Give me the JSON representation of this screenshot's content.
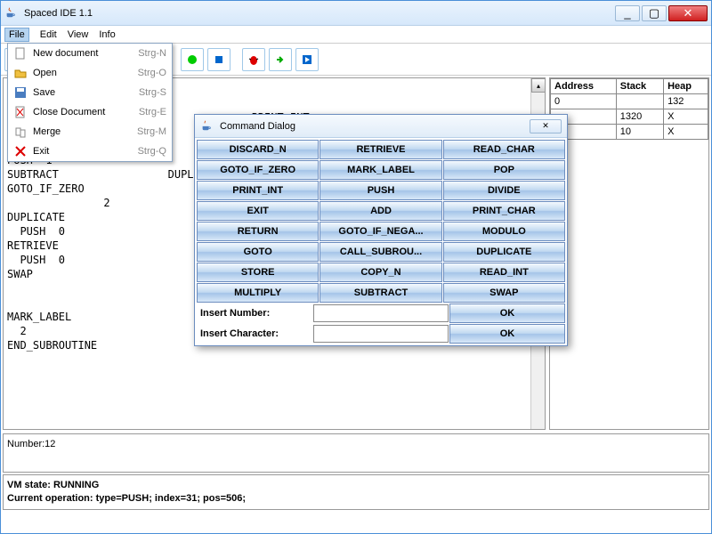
{
  "window": {
    "title": "Spaced IDE 1.1"
  },
  "menubar": [
    "File",
    "Edit",
    "View",
    "Info"
  ],
  "file_menu": [
    {
      "icon": "new",
      "label": "New document",
      "shortcut": "Strg-N"
    },
    {
      "icon": "open",
      "label": "Open",
      "shortcut": "Strg-O"
    },
    {
      "icon": "save",
      "label": "Save",
      "shortcut": "Strg-S"
    },
    {
      "icon": "close",
      "label": "Close Document",
      "shortcut": "Strg-E"
    },
    {
      "icon": "merge",
      "label": "Merge",
      "shortcut": "Strg-M"
    },
    {
      "icon": "exit",
      "label": "Exit",
      "shortcut": "Strg-Q"
    }
  ],
  "editor_text": "\n\n                                      PRINT_INT\nMARK_LABEL\n  1\nPUSH  1\nSUBTRACT                 DUPLICAT\nGOTO_IF_ZERO\n               2\nDUPLICATE\n  PUSH  0\nRETRIEVE\n  PUSH  0\nSWAP\n\n\nMARK_LABEL\n  2\nEND_SUBROUTINE",
  "mem_headers": [
    "Address",
    "Stack",
    "Heap"
  ],
  "mem_rows": [
    [
      "0",
      "",
      "132"
    ],
    [
      "",
      "1320",
      "X"
    ],
    [
      "",
      "10",
      "X"
    ]
  ],
  "output": "Number:12",
  "status_line1": "VM state: RUNNING",
  "status_line2": "Current operation: type=PUSH; index=31; pos=506;",
  "dialog": {
    "title": "Command Dialog",
    "commands": [
      "DISCARD_N",
      "RETRIEVE",
      "READ_CHAR",
      "GOTO_IF_ZERO",
      "MARK_LABEL",
      "POP",
      "PRINT_INT",
      "PUSH",
      "DIVIDE",
      "EXIT",
      "ADD",
      "PRINT_CHAR",
      "RETURN",
      "GOTO_IF_NEGA...",
      "MODULO",
      "GOTO",
      "CALL_SUBROU...",
      "DUPLICATE",
      "STORE",
      "COPY_N",
      "READ_INT",
      "MULTIPLY",
      "SUBTRACT",
      "SWAP"
    ],
    "insert_number_label": "Insert Number:",
    "insert_char_label": "Insert Character:",
    "ok_label": "OK"
  }
}
